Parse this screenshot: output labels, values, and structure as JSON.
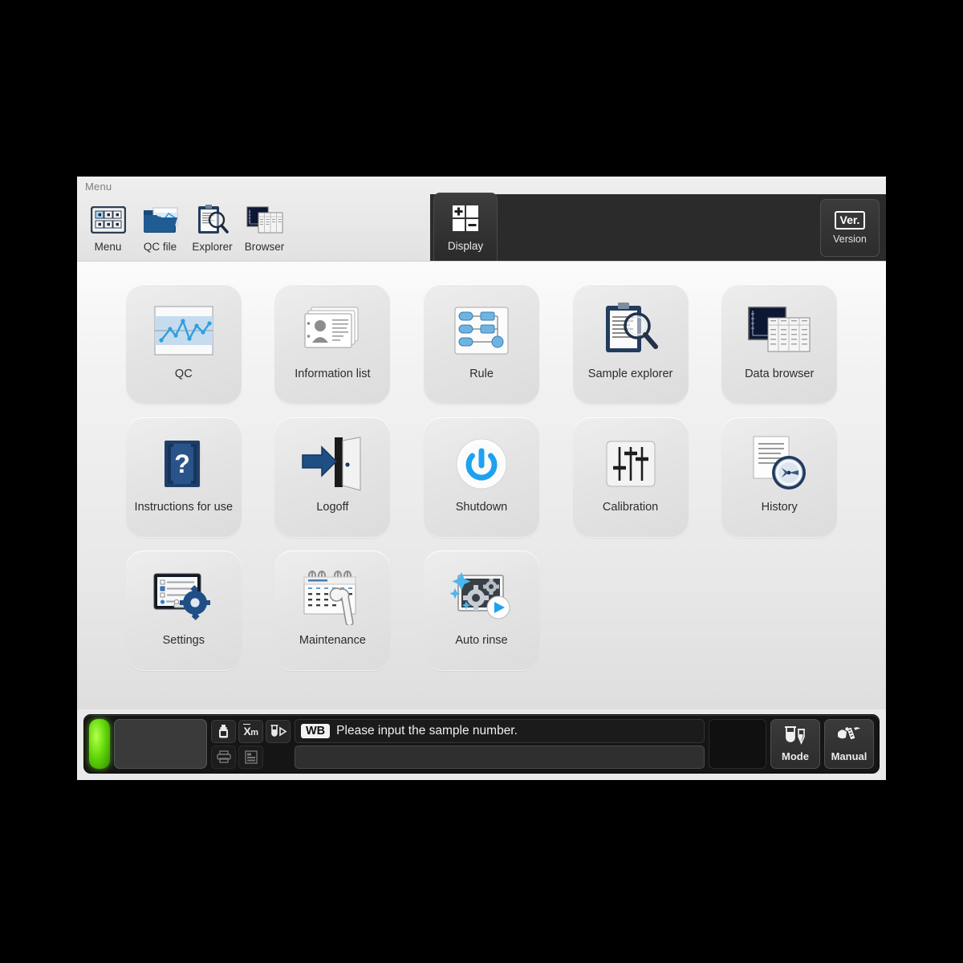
{
  "window": {
    "title": "Menu"
  },
  "toolbar": {
    "items": [
      {
        "label": "Menu",
        "icon": "menu-grid-icon"
      },
      {
        "label": "QC file",
        "icon": "qc-file-folder-icon"
      },
      {
        "label": "Explorer",
        "icon": "clipboard-magnifier-icon"
      },
      {
        "label": "Browser",
        "icon": "chart-table-icon"
      }
    ],
    "display_tab": {
      "label": "Display",
      "icon": "plus-minus-grid-icon"
    },
    "version_tab": {
      "label": "Version",
      "badge": "Ver.",
      "icon": "version-badge-icon"
    }
  },
  "menu_grid": {
    "tiles": [
      {
        "label": "QC",
        "icon": "qc-line-chart-icon"
      },
      {
        "label": "Information list",
        "icon": "id-cards-icon"
      },
      {
        "label": "Rule",
        "icon": "flowchart-rule-icon"
      },
      {
        "label": "Sample explorer",
        "icon": "clipboard-magnifier-icon"
      },
      {
        "label": "Data browser",
        "icon": "chart-table-icon"
      },
      {
        "label": "Instructions for use",
        "icon": "blue-book-question-icon"
      },
      {
        "label": "Logoff",
        "icon": "door-exit-arrow-icon"
      },
      {
        "label": "Shutdown",
        "icon": "power-button-icon"
      },
      {
        "label": "Calibration",
        "icon": "sliders-icon"
      },
      {
        "label": "History",
        "icon": "document-clock-icon"
      },
      {
        "label": "Settings",
        "icon": "screen-gear-icon"
      },
      {
        "label": "Maintenance",
        "icon": "calendar-wrench-icon"
      },
      {
        "label": "Auto rinse",
        "icon": "sparkle-gear-play-icon"
      }
    ]
  },
  "status_bar": {
    "led": {
      "state": "green",
      "color": "#63d90a"
    },
    "mode_badge": "WB",
    "message": "Please input the sample number.",
    "sample_input_value": "",
    "icon_buttons": [
      {
        "name": "reagent-bottle-icon",
        "enabled": true
      },
      {
        "name": "xm-mean-icon",
        "enabled": true
      },
      {
        "name": "tube-arrow-icon",
        "enabled": true
      },
      {
        "name": "printer-icon",
        "enabled": false
      },
      {
        "name": "list-output-icon",
        "enabled": false
      }
    ],
    "buttons": [
      {
        "label": "Mode",
        "icon": "sample-tubes-icon"
      },
      {
        "label": "Manual",
        "icon": "hand-tube-icon"
      }
    ]
  }
}
